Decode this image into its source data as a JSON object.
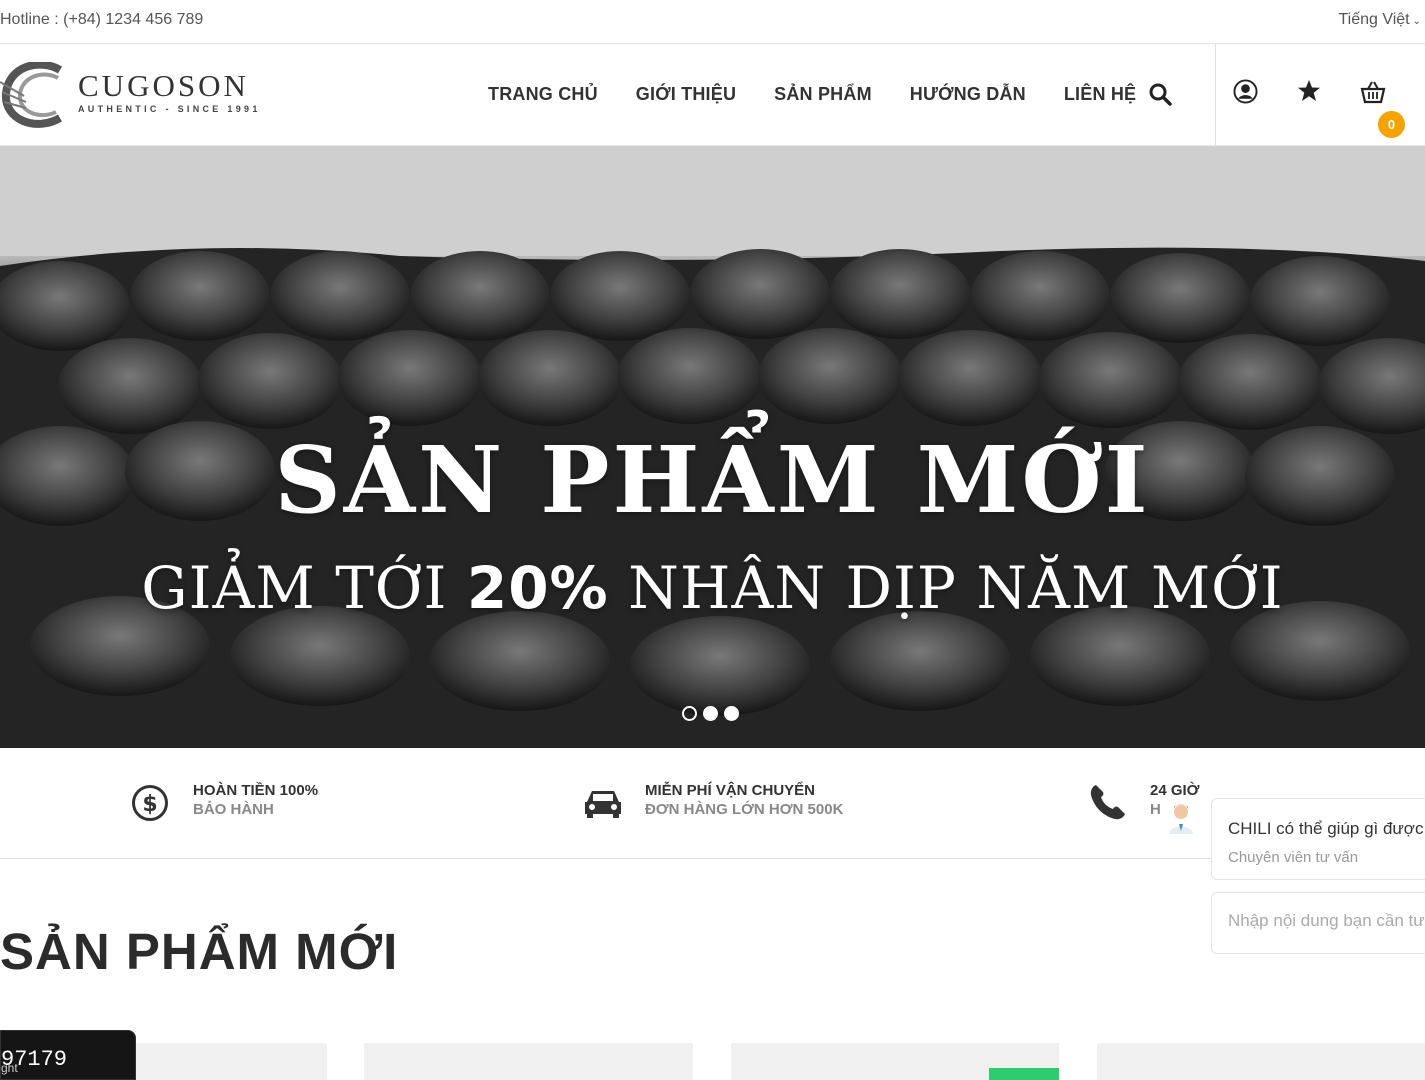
{
  "topbar": {
    "hotline": "Hotline : (+84) 1234 456 789",
    "language": "Tiếng Việt"
  },
  "logo": {
    "name": "CUGOSON",
    "tagline": "AUTHENTIC - SINCE 1991"
  },
  "nav": {
    "items": [
      {
        "label": "TRANG CHỦ"
      },
      {
        "label": "GIỚI THIỆU"
      },
      {
        "label": "SẢN PHẨM"
      },
      {
        "label": "HƯỚNG DẪN"
      },
      {
        "label": "LIÊN HỆ"
      }
    ]
  },
  "header_icons": {
    "search": "search-icon",
    "account": "user-icon",
    "wishlist": "star-icon",
    "cart": "cart-icon",
    "cart_count": "0"
  },
  "hero": {
    "title": "SẢN PHẨM MỚI",
    "subtitle_pre": "GIẢM TỚI ",
    "subtitle_bold": "20%",
    "subtitle_post": " NHÂN DỊP NĂM MỚI",
    "slides_total": 3,
    "active_slide": 2
  },
  "features": [
    {
      "icon": "dollar-icon",
      "title": "HOÀN TIỀN 100%",
      "subtitle": "BẢO HÀNH"
    },
    {
      "icon": "car-icon",
      "title": "MIỄN PHÍ VẬN CHUYỂN",
      "subtitle": "ĐƠN HÀNG LỚN HƠN 500K"
    },
    {
      "icon": "phone-icon",
      "title": "24 GIỜ",
      "subtitle": "H"
    }
  ],
  "section": {
    "title": "SẢN PHẨM MỚI"
  },
  "chat": {
    "message": "CHILI có thể giúp gì được",
    "role": "Chuyên viên tư vấn",
    "input_placeholder": "Nhập nội dung bạn cần tư"
  },
  "counter": {
    "number": "97179",
    "label": "ght"
  },
  "colors": {
    "badge": "#f5a300",
    "sale": "#2ecc71",
    "text": "#333333"
  }
}
